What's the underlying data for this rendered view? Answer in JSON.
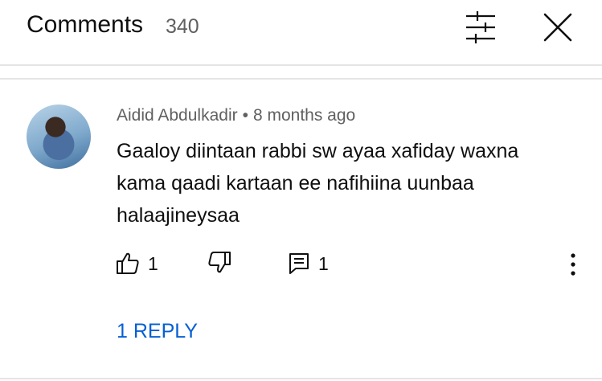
{
  "header": {
    "title": "Comments",
    "count": "340",
    "filter_icon": "sort-sliders-icon",
    "close_icon": "close-icon"
  },
  "comment": {
    "author": "Aidid Abdulkadir",
    "separator": "•",
    "time": "8 months ago",
    "text_lines": [
      "Gaaloy diintaan rabbi sw ayaa xafiday waxna",
      "kama qaadi kartaan ee nafihiina uunbaa",
      "halaajineysaa"
    ],
    "likes": "1",
    "replies_count": "1",
    "replies_label": "1 REPLY"
  },
  "icons": {
    "like": "thumbs-up-icon",
    "dislike": "thumbs-down-icon",
    "reply": "reply-comment-icon",
    "more": "more-vertical-icon"
  },
  "colors": {
    "primary_text": "#0f0f0f",
    "secondary_text": "#606060",
    "link": "#065fd4",
    "divider": "#e5e5e5"
  }
}
